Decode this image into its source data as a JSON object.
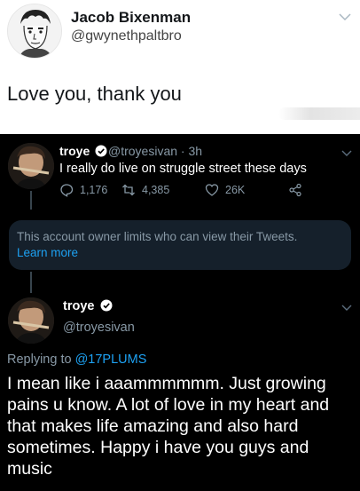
{
  "top_tweet": {
    "name": "Jacob Bixenman",
    "handle": "@gwynethpaltbro",
    "text": "Love you, thank you"
  },
  "tweet1": {
    "name": "troye",
    "handle": "@troyesivan · 3h",
    "text": "I really do live on struggle street these days",
    "replies": "1,176",
    "retweets": "4,385",
    "likes": "26K",
    "icons": [
      "reply-icon",
      "retweet-icon",
      "like-icon",
      "share-icon"
    ]
  },
  "notice": {
    "message": "This account owner limits who can view their Tweets.",
    "link": "Learn more"
  },
  "tweet2": {
    "name": "troye",
    "handle": "@troyesivan",
    "replying_prefix": "Replying to ",
    "replying_to": "@17PLUMS",
    "text": "I mean like i aaammmmmm. Just growing pains u know. A lot of love in my heart and that makes life amazing and also hard sometimes. Happy i have you guys and music"
  },
  "colors": {
    "dark_bg": "#000000",
    "card_bg": "#15202b",
    "muted": "#8899a6",
    "accent": "#1da1f2"
  }
}
